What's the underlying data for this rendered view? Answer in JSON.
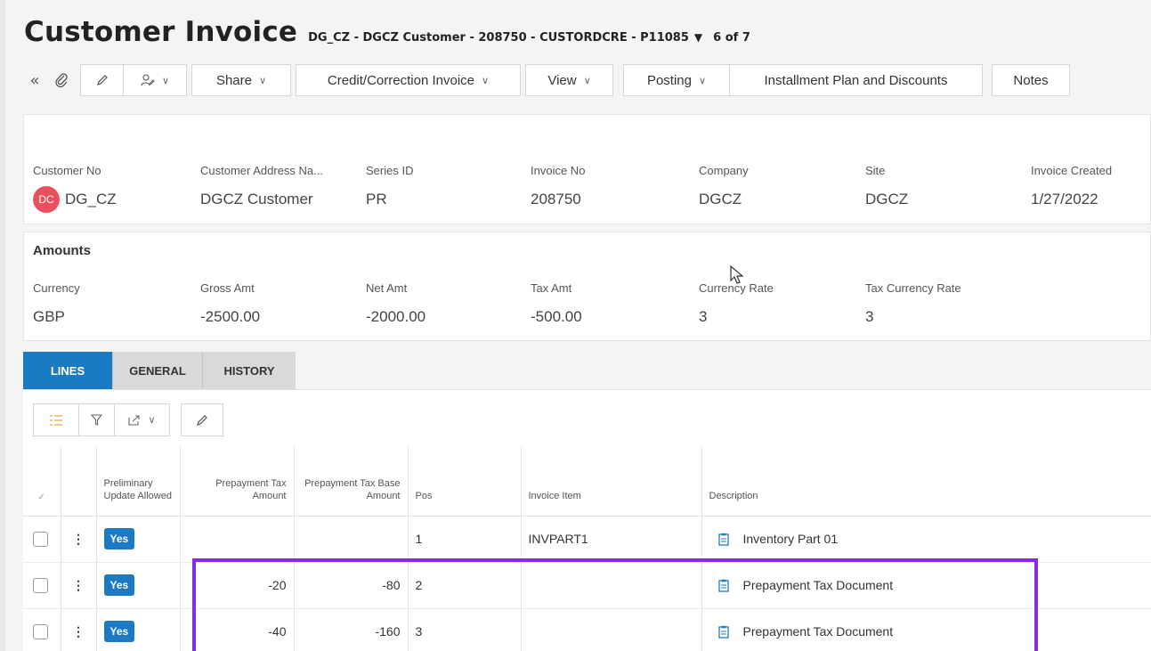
{
  "header": {
    "title": "Customer Invoice",
    "record": "DG_CZ - DGCZ Customer - 208750 - CUSTORDCRE - P11085",
    "caret": "▼",
    "position": "6 of 7"
  },
  "toolbar": {
    "collapse_icon": "«",
    "attach_icon": "paperclip-icon",
    "share_label": "Share",
    "credit_label": "Credit/Correction Invoice",
    "view_label": "View",
    "posting_label": "Posting",
    "installment_label": "Installment Plan and Discounts",
    "notes_label": "Notes",
    "chevron": "∨"
  },
  "summary": {
    "customer_no_label": "Customer No",
    "customer_no": "DG_CZ",
    "avatar_initials": "DC",
    "address_label": "Customer Address Na...",
    "address": "DGCZ Customer",
    "series_label": "Series ID",
    "series": "PR",
    "invoice_no_label": "Invoice No",
    "invoice_no": "208750",
    "company_label": "Company",
    "company": "DGCZ",
    "site_label": "Site",
    "site": "DGCZ",
    "created_label": "Invoice Created",
    "created": "1/27/2022"
  },
  "amounts": {
    "title": "Amounts",
    "currency_label": "Currency",
    "currency": "GBP",
    "gross_label": "Gross Amt",
    "gross": "-2500.00",
    "net_label": "Net Amt",
    "net": "-2000.00",
    "tax_label": "Tax Amt",
    "tax": "-500.00",
    "rate_label": "Currency Rate",
    "rate": "3",
    "tax_rate_label": "Tax Currency Rate",
    "tax_rate": "3"
  },
  "tabs": {
    "lines": "LINES",
    "general": "GENERAL",
    "history": "HISTORY"
  },
  "grid": {
    "headers": {
      "select": "✓",
      "preliminary": "Preliminary Update Allowed",
      "prepay_tax_amount": "Prepayment Tax Amount",
      "prepay_base_amount": "Prepayment Tax Base Amount",
      "pos": "Pos",
      "invoice_item": "Invoice Item",
      "description": "Description"
    },
    "rows": [
      {
        "preliminary": "Yes",
        "prepay_tax_amount": "",
        "prepay_base_amount": "",
        "pos": "1",
        "invoice_item": "INVPART1",
        "description": "Inventory Part 01"
      },
      {
        "preliminary": "Yes",
        "prepay_tax_amount": "-20",
        "prepay_base_amount": "-80",
        "pos": "2",
        "invoice_item": "",
        "description": "Prepayment Tax Document"
      },
      {
        "preliminary": "Yes",
        "prepay_tax_amount": "-40",
        "prepay_base_amount": "-160",
        "pos": "3",
        "invoice_item": "",
        "description": "Prepayment Tax Document"
      }
    ]
  },
  "colors": {
    "accent": "#1a7bc4",
    "avatar": "#e8505b",
    "highlight": "#8a2be2"
  }
}
